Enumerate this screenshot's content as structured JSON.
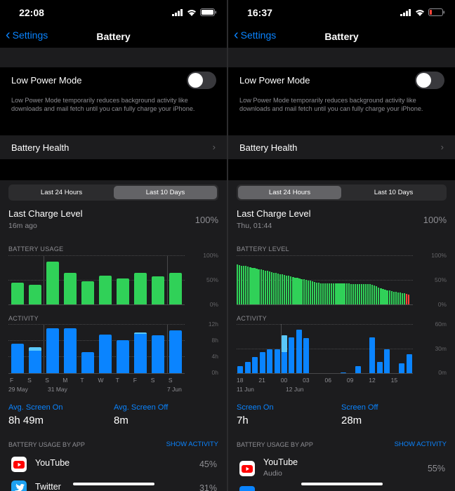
{
  "left": {
    "status_time": "22:08",
    "back_label": "Settings",
    "nav_title": "Battery",
    "low_power_label": "Low Power Mode",
    "low_power_note": "Low Power Mode temporarily reduces background activity like downloads and mail fetch until you can fully charge your iPhone.",
    "health_label": "Battery Health",
    "segments": [
      "Last 24 Hours",
      "Last 10 Days"
    ],
    "selected_segment": 1,
    "last_charge_label": "Last Charge Level",
    "last_charge_sub": "16m ago",
    "last_charge_value": "100%",
    "usage_header": "BATTERY USAGE",
    "usage_ticks": [
      "100%",
      "50%",
      "0%"
    ],
    "activity_header": "ACTIVITY",
    "activity_ticks": [
      "12h",
      "8h",
      "4h",
      "0h"
    ],
    "day_labels": [
      "F",
      "S",
      "S",
      "M",
      "T",
      "W",
      "T",
      "F",
      "S",
      "S"
    ],
    "date_labels": [
      "29 May",
      "31 May",
      "7 Jun"
    ],
    "avg_on_label": "Avg. Screen On",
    "avg_on_value": "8h 49m",
    "avg_off_label": "Avg. Screen Off",
    "avg_off_value": "8m",
    "by_app_header": "BATTERY USAGE BY APP",
    "show_activity": "SHOW ACTIVITY",
    "apps": [
      {
        "name": "YouTube",
        "sub": "",
        "pct": "45%",
        "color": "#ff0000"
      },
      {
        "name": "Twitter",
        "sub": "",
        "pct": "31%",
        "color": "#1da1f2"
      }
    ]
  },
  "right": {
    "status_time": "16:37",
    "back_label": "Settings",
    "nav_title": "Battery",
    "low_power_label": "Low Power Mode",
    "low_power_note": "Low Power Mode temporarily reduces background activity like downloads and mail fetch until you can fully charge your iPhone.",
    "health_label": "Battery Health",
    "segments": [
      "Last 24 Hours",
      "Last 10 Days"
    ],
    "selected_segment": 0,
    "last_charge_label": "Last Charge Level",
    "last_charge_sub": "Thu, 01:44",
    "last_charge_value": "100%",
    "level_header": "BATTERY LEVEL",
    "level_ticks": [
      "100%",
      "50%",
      "0%"
    ],
    "activity_header": "ACTIVITY",
    "activity_ticks": [
      "60m",
      "30m",
      "0m"
    ],
    "hour_labels": [
      "18",
      "21",
      "00",
      "03",
      "06",
      "09",
      "12",
      "15"
    ],
    "date_labels": [
      "11 Jun",
      "12 Jun"
    ],
    "screen_on_label": "Screen On",
    "screen_on_value": "7h",
    "screen_off_label": "Screen Off",
    "screen_off_value": "28m",
    "by_app_header": "BATTERY USAGE BY APP",
    "show_activity": "SHOW ACTIVITY",
    "apps": [
      {
        "name": "YouTube",
        "sub": "Audio",
        "pct": "55%",
        "color": "#ff0000"
      }
    ]
  },
  "colors": {
    "green": "#30d158",
    "blue": "#0a84ff",
    "light_blue": "#5ac8fa",
    "red": "#ff453a",
    "accent": "#0a84ff"
  },
  "chart_data": [
    {
      "type": "bar",
      "title": "BATTERY USAGE",
      "categories": [
        "F",
        "S",
        "S",
        "M",
        "T",
        "W",
        "T",
        "F",
        "S",
        "S"
      ],
      "ylim": [
        0,
        100
      ],
      "series": [
        {
          "values": [
            45,
            40,
            87,
            65,
            47,
            58,
            53,
            65,
            57,
            65
          ]
        }
      ]
    },
    {
      "type": "bar",
      "title": "ACTIVITY",
      "categories": [
        "F",
        "S",
        "S",
        "M",
        "T",
        "W",
        "T",
        "F",
        "S",
        "S"
      ],
      "ylim": [
        0,
        12
      ],
      "series": [
        {
          "values": [
            7.2,
            5.5,
            11.0,
            11.0,
            5.1,
            9.5,
            8.0,
            9.6,
            9.2,
            10.5
          ]
        },
        {
          "values": [
            0,
            0.8,
            0,
            0,
            0,
            0,
            0,
            0.4,
            0,
            0
          ]
        }
      ]
    },
    {
      "type": "bar",
      "title": "BATTERY LEVEL",
      "xlabel": "",
      "ylim": [
        0,
        100
      ],
      "series": [
        {
          "values": [
            81,
            80,
            79,
            78,
            78,
            77,
            76,
            75,
            74,
            73,
            72,
            71,
            70,
            69,
            68,
            67,
            66,
            65,
            64,
            63,
            62,
            61,
            60,
            59,
            58,
            57,
            56,
            55,
            54,
            53,
            52,
            51,
            50,
            49,
            48,
            47,
            46,
            45,
            44,
            43,
            43,
            43,
            43,
            43,
            43,
            43,
            43,
            43,
            43,
            43,
            43,
            43,
            43,
            42,
            42,
            42,
            42,
            42,
            42,
            41,
            41,
            41,
            41,
            40,
            39,
            37,
            35,
            33,
            31,
            30,
            29,
            28,
            27,
            26,
            26,
            25,
            24,
            23,
            23,
            22,
            20
          ]
        }
      ]
    },
    {
      "type": "bar",
      "title": "ACTIVITY",
      "categories": [
        "18",
        "21",
        "00",
        "03",
        "06",
        "09",
        "12",
        "15"
      ],
      "ylim": [
        0,
        60
      ],
      "series": [
        {
          "values": [
            9,
            14,
            20,
            26,
            29,
            29,
            26,
            44,
            53,
            43,
            0,
            0,
            0,
            0,
            1,
            0,
            9,
            0,
            44,
            14,
            29,
            0,
            12,
            23
          ]
        },
        {
          "values": [
            0,
            0,
            0,
            0,
            0,
            0,
            20,
            0,
            0,
            0,
            0,
            0,
            0,
            0,
            0,
            0,
            0,
            0,
            0,
            0,
            0,
            0,
            0,
            0
          ]
        }
      ]
    }
  ]
}
